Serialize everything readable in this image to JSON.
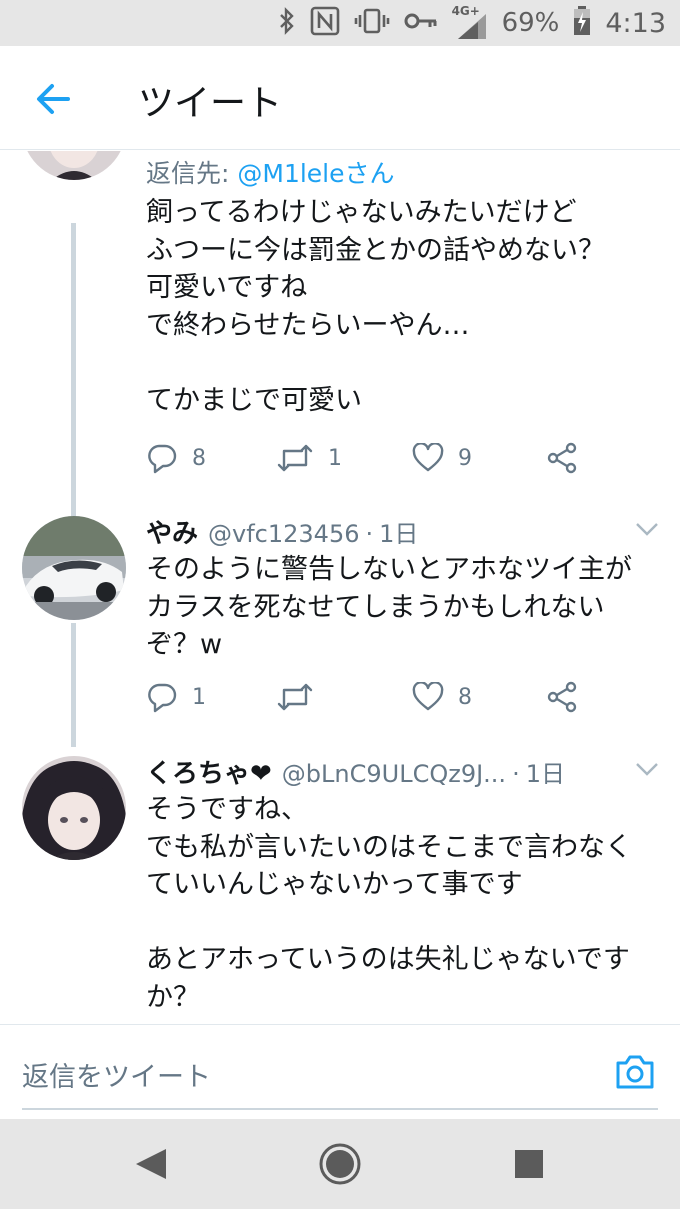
{
  "status_bar": {
    "network": "4G+",
    "battery": "69%",
    "time": "4:13"
  },
  "header": {
    "title": "ツイート"
  },
  "tweets": [
    {
      "replying_prefix": "返信先: ",
      "replying_to": "@M1leleさん",
      "text": "飼ってるわけじゃないみたいだけど\nふつーに今は罰金とかの話やめない？\n可愛いですね\nで終わらせたらいーやん…\n\nてかまじで可愛い",
      "replies": "8",
      "retweets": "1",
      "likes": "9"
    },
    {
      "name": "やみ",
      "handle": "@vfc123456",
      "time": "1日",
      "text": "そのように警告しないとアホなツイ主が\nカラスを死なせてしまうかもしれない\nぞ？w",
      "replies": "1",
      "retweets": "",
      "likes": "8"
    },
    {
      "name": "くろちゃ❤",
      "handle": "@bLnC9ULCQz9J...",
      "time": "1日",
      "text": "そうですね、\nでも私が言いたいのはそこまで言わなく\nていいんじゃないかって事です\n\nあとアホっていうのは失礼じゃないです\nか？"
    }
  ],
  "reply_bar": {
    "placeholder": "返信をツイート"
  },
  "icons": {
    "back": "back-arrow-icon",
    "reply": "reply-icon",
    "retweet": "retweet-icon",
    "like": "heart-icon",
    "share": "share-icon",
    "camera": "camera-icon"
  },
  "colors": {
    "accent": "#1da1f2",
    "secondary_text": "#657786",
    "primary_text": "#14171a"
  }
}
